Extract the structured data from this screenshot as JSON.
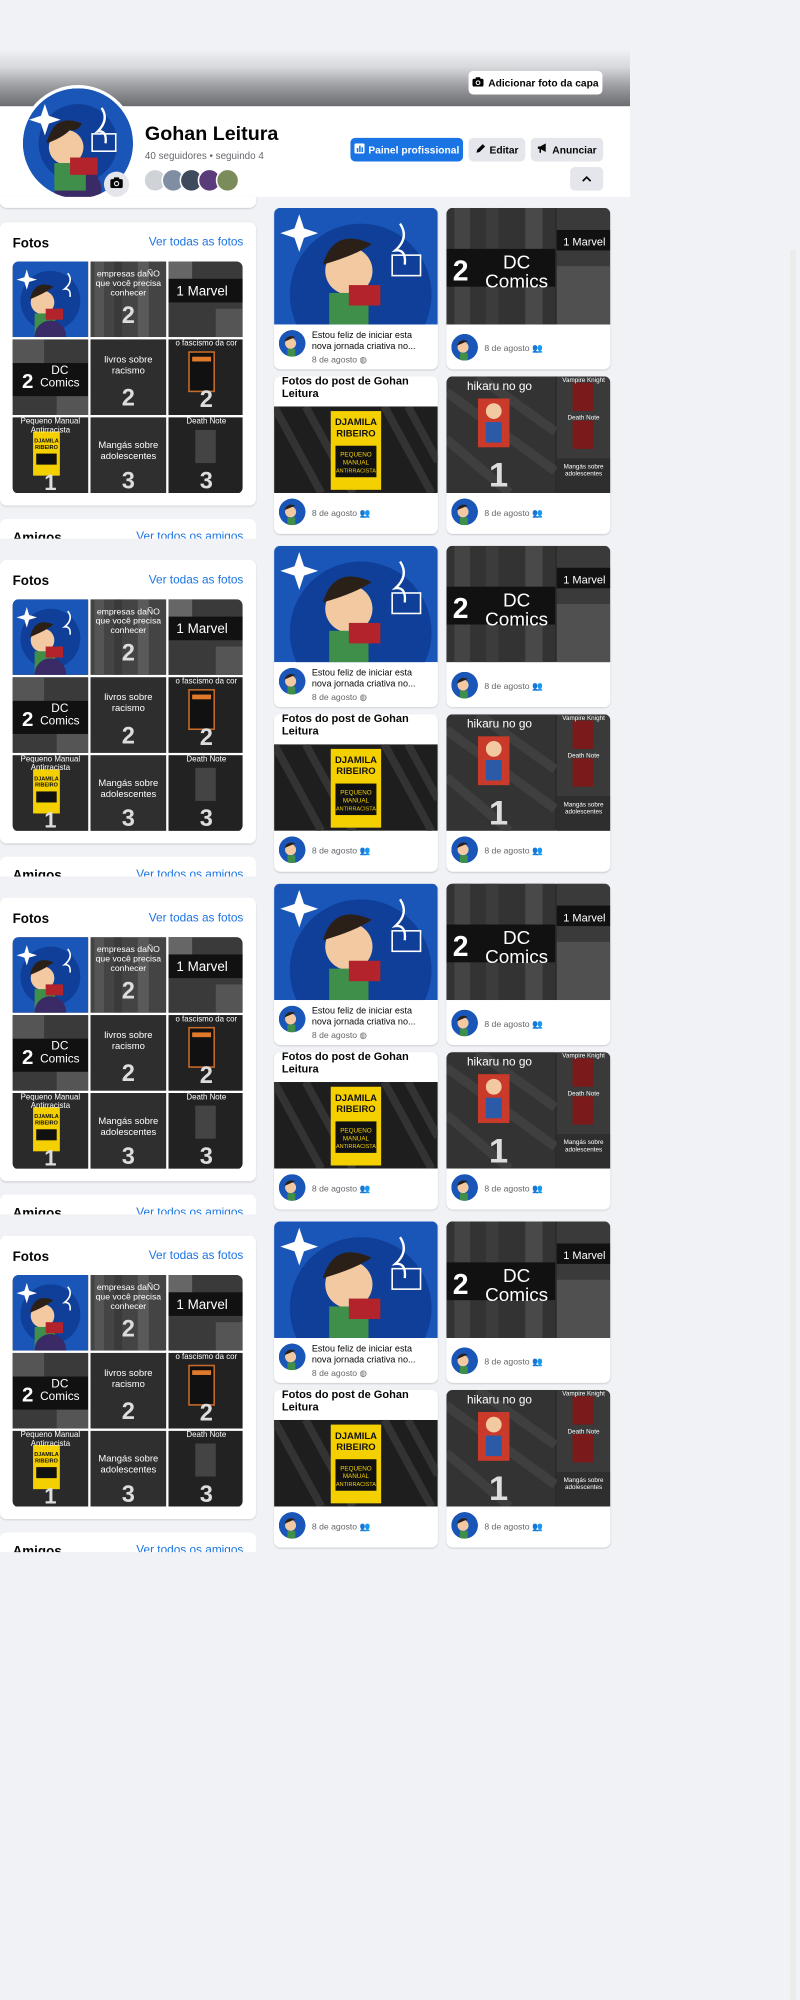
{
  "profile": {
    "name": "Gohan Leitura",
    "stats": "40 seguidores • seguindo 4"
  },
  "cover": {
    "add_cover_label": "Adicionar foto da capa"
  },
  "buttons": {
    "pro_panel": "Painel profissional",
    "edit": "Editar",
    "advertise": "Anunciar"
  },
  "photos_section": {
    "title": "Fotos",
    "see_all": "Ver todas as fotos"
  },
  "friends_section": {
    "title": "Amigos",
    "see_all": "Ver todos os amigos"
  },
  "tiles": {
    "t2": "empresas daÑO que você precisa conhecer",
    "t3": "1 Marvel",
    "t4": "DC Comics",
    "t5": "livros sobre racismo",
    "t6": "o fascismo da cor",
    "t7": "Pequeno Manual Antirracista",
    "t8": "Mangás sobre adolescentes",
    "t9": "Death Note",
    "num1": "1",
    "num2": "2",
    "num3": "3",
    "book_author": "DJAMILA RIBEIRO",
    "book_title": "PEQUENO MANUAL ANTIRRACISTA",
    "hikaru": "hikaru no go",
    "vampire": "Vampire Knight",
    "deathnote": "Death Note"
  },
  "posts": {
    "p1_text": "Estou feliz de iniciar esta nova jornada criativa no...",
    "p3_title": "Fotos do post de Gohan Leitura",
    "date": "8 de agosto"
  },
  "colors": {
    "accent": "#1b74e4",
    "bg": "#f0f2f5"
  }
}
